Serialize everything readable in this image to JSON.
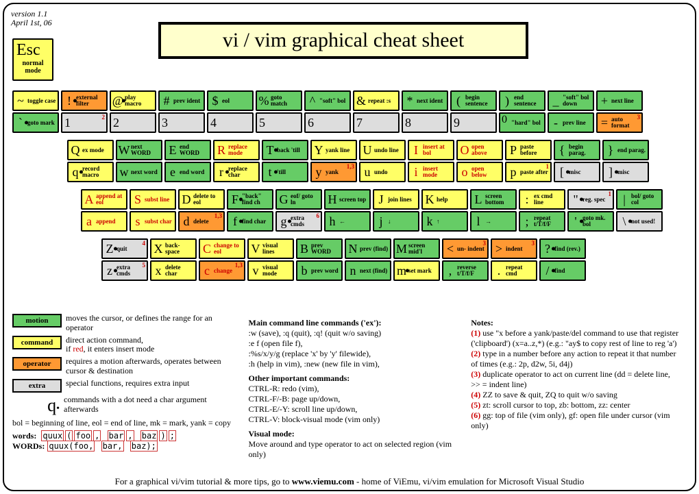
{
  "meta": {
    "version": "version 1.1",
    "date": "April 1st, 06"
  },
  "title": "vi / vim graphical cheat sheet",
  "esc": {
    "label": "Esc",
    "sub": "normal mode"
  },
  "legend": {
    "motion": {
      "tag": "motion",
      "desc": "moves the cursor, or defines the range for an operator"
    },
    "command": {
      "tag": "command",
      "desc_a": "direct action command,",
      "desc_b": "if ",
      "desc_c": "red",
      "desc_d": ", it enters insert mode"
    },
    "operator": {
      "tag": "operator",
      "desc": "requires a motion afterwards, operates between cursor & destination"
    },
    "extra": {
      "tag": "extra",
      "desc": "special functions, requires extra input"
    },
    "qdot": "commands with a dot need a char argument afterwards",
    "abbrev": "bol = beginning of line, eol = end of line, mk = mark, yank = copy",
    "words_lbl": "words:",
    "WORDS_lbl": "WORDs:",
    "sample": "quux(foo, bar, baz);"
  },
  "main_cmds": {
    "h1": "Main command line commands ('ex'):",
    "l1": ":w (save), :q (quit), :q! (quit w/o saving)",
    "l2": ":e f (open file f),",
    "l3": ":%s/x/y/g (replace 'x' by 'y' filewide),",
    "l4": ":h (help in vim), :new (new file in vim),",
    "h2": "Other important commands:",
    "l5": "CTRL-R: redo (vim),",
    "l6": "CTRL-F/-B: page up/down,",
    "l7": "CTRL-E/-Y: scroll line up/down,",
    "l8": "CTRL-V: block-visual mode (vim only)",
    "h3": "Visual mode:",
    "l9": "Move around and type operator to act on selected region (vim only)"
  },
  "notes": {
    "h": "Notes:",
    "n1": "use \"x before a yank/paste/del command to use that register ('clipboard') (x=a..z,*) (e.g.: \"ay$ to copy rest of line to reg 'a')",
    "n2": "type in a number before any action to repeat it that number of times (e.g.: 2p, d2w, 5i, d4j)",
    "n3": "duplicate operator to act on current line (dd = delete line, >> = indent line)",
    "n4": "ZZ to save & quit, ZQ to quit w/o saving",
    "n5": "zt: scroll cursor to top, zb: bottom, zz: center",
    "n6": "gg: top of file (vim only), gf: open file under cursor (vim only)"
  },
  "footer": {
    "a": "For a graphical vi/vim tutorial & more tips, go to ",
    "b": "www.viemu.com",
    "c": "  - home of ViEmu, vi/vim emulation for Microsoft Visual Studio"
  },
  "rows": {
    "r1a": [
      {
        "s": "~",
        "l": "toggle case",
        "c": "command"
      },
      {
        "s": "!",
        "l": "external filter",
        "c": "operator",
        "dot": true
      },
      {
        "s": "@",
        "l": "play macro",
        "c": "command",
        "dot": true
      },
      {
        "s": "#",
        "l": "prev ident",
        "c": "motion"
      },
      {
        "s": "$",
        "l": "eol",
        "c": "motion"
      },
      {
        "s": "%",
        "l": "goto match",
        "c": "motion"
      },
      {
        "s": "^",
        "l": "\"soft\" bol",
        "c": "motion"
      },
      {
        "s": "&",
        "l": "repeat :s",
        "c": "command"
      },
      {
        "s": "*",
        "l": "next ident",
        "c": "motion"
      },
      {
        "s": "(",
        "l": "begin sentence",
        "c": "motion"
      },
      {
        "s": ")",
        "l": "end sentence",
        "c": "motion"
      },
      {
        "s": "_",
        "l": "\"soft\" bol down",
        "c": "motion"
      },
      {
        "s": "+",
        "l": "next line",
        "c": "motion"
      }
    ],
    "r1b": [
      {
        "s": "`",
        "l": "goto mark",
        "c": "motion",
        "dot": true
      },
      {
        "n": "1",
        "sup": "2"
      },
      {
        "n": "2"
      },
      {
        "n": "3"
      },
      {
        "n": "4"
      },
      {
        "n": "5"
      },
      {
        "n": "6"
      },
      {
        "n": "7"
      },
      {
        "n": "8"
      },
      {
        "n": "9"
      },
      {
        "s": "0",
        "l": "\"hard\" bol",
        "c": "motion",
        "zero": true
      },
      {
        "s": "-",
        "l": "prev line",
        "c": "motion"
      },
      {
        "s": "=",
        "l": "auto format",
        "c": "operator",
        "sup": "3"
      }
    ],
    "r2a": [
      {
        "s": "Q",
        "l": "ex mode",
        "c": "command"
      },
      {
        "s": "W",
        "l": "next WORD",
        "c": "motion"
      },
      {
        "s": "E",
        "l": "end WORD",
        "c": "motion"
      },
      {
        "s": "R",
        "l": "replace mode",
        "c": "command",
        "red": true
      },
      {
        "s": "T",
        "l": "back 'till",
        "c": "motion",
        "dot": true
      },
      {
        "s": "Y",
        "l": "yank line",
        "c": "command"
      },
      {
        "s": "U",
        "l": "undo line",
        "c": "command"
      },
      {
        "s": "I",
        "l": "insert at bol",
        "c": "command",
        "red": true
      },
      {
        "s": "O",
        "l": "open above",
        "c": "command",
        "red": true
      },
      {
        "s": "P",
        "l": "paste before",
        "c": "command"
      },
      {
        "s": "{",
        "l": "begin parag.",
        "c": "motion"
      },
      {
        "s": "}",
        "l": "end parag.",
        "c": "motion"
      }
    ],
    "r2b": [
      {
        "s": "q",
        "l": "record macro",
        "c": "command",
        "dot": true
      },
      {
        "s": "w",
        "l": "next word",
        "c": "motion"
      },
      {
        "s": "e",
        "l": "end word",
        "c": "motion"
      },
      {
        "s": "r",
        "l": "replace char",
        "c": "command",
        "dot": true
      },
      {
        "s": "t",
        "l": "'till",
        "c": "motion",
        "dot": true
      },
      {
        "s": "y",
        "l": "yank",
        "c": "operator",
        "sup": "1,3"
      },
      {
        "s": "u",
        "l": "undo",
        "c": "command"
      },
      {
        "s": "i",
        "l": "insert mode",
        "c": "command",
        "red": true
      },
      {
        "s": "o",
        "l": "open below",
        "c": "command",
        "red": true
      },
      {
        "s": "p",
        "l": "paste after",
        "c": "command",
        "sup": "1"
      },
      {
        "s": "[",
        "l": "misc",
        "c": "extra",
        "dot": true
      },
      {
        "s": "]",
        "l": "misc",
        "c": "extra",
        "dot": true
      }
    ],
    "r3a": [
      {
        "s": "A",
        "l": "append at eol",
        "c": "command",
        "red": true
      },
      {
        "s": "S",
        "l": "subst line",
        "c": "command",
        "red": true
      },
      {
        "s": "D",
        "l": "delete to eol",
        "c": "command"
      },
      {
        "s": "F",
        "l": "\"back\" find ch",
        "c": "motion",
        "dot": true
      },
      {
        "s": "G",
        "l": "eof/ goto ln",
        "c": "motion"
      },
      {
        "s": "H",
        "l": "screen top",
        "c": "motion"
      },
      {
        "s": "J",
        "l": "join lines",
        "c": "command"
      },
      {
        "s": "K",
        "l": "help",
        "c": "command"
      },
      {
        "s": "L",
        "l": "screen bottom",
        "c": "motion"
      },
      {
        "s": ":",
        "l": "ex cmd line",
        "c": "command"
      },
      {
        "s": "\"",
        "l": "reg. spec",
        "c": "extra",
        "dot": true,
        "sup": "1"
      },
      {
        "s": "|",
        "l": "bol/ goto col",
        "c": "motion"
      }
    ],
    "r3b": [
      {
        "s": "a",
        "l": "append",
        "c": "command",
        "red": true
      },
      {
        "s": "s",
        "l": "subst char",
        "c": "command",
        "red": true
      },
      {
        "s": "d",
        "l": "delete",
        "c": "operator",
        "sup": "1,3"
      },
      {
        "s": "f",
        "l": "find char",
        "c": "motion",
        "dot": true
      },
      {
        "s": "g",
        "l": "extra cmds",
        "c": "extra",
        "dot": true,
        "sup": "6"
      },
      {
        "s": "h",
        "l": "←",
        "c": "motion",
        "arrow": true
      },
      {
        "s": "j",
        "l": "↓",
        "c": "motion",
        "arrow": true
      },
      {
        "s": "k",
        "l": "↑",
        "c": "motion",
        "arrow": true
      },
      {
        "s": "l",
        "l": "→",
        "c": "motion",
        "arrow": true
      },
      {
        "s": ";",
        "l": "repeat t/T/f/F",
        "c": "motion"
      },
      {
        "s": "'",
        "l": "goto mk. bol",
        "c": "motion",
        "dot": true
      },
      {
        "s": "\\",
        "l": "not used!",
        "c": "extra",
        "dot": true
      }
    ],
    "r4a": [
      {
        "s": "Z",
        "l": "quit",
        "c": "extra",
        "dot": true,
        "sup": "4"
      },
      {
        "s": "X",
        "l": "back- space",
        "c": "command"
      },
      {
        "s": "C",
        "l": "change to eol",
        "c": "command",
        "red": true
      },
      {
        "s": "V",
        "l": "visual lines",
        "c": "command"
      },
      {
        "s": "B",
        "l": "prev WORD",
        "c": "motion"
      },
      {
        "s": "N",
        "l": "prev (find)",
        "c": "motion"
      },
      {
        "s": "M",
        "l": "screen mid'l",
        "c": "motion"
      },
      {
        "s": "<",
        "l": "un- indent",
        "c": "operator",
        "sup": "3"
      },
      {
        "s": ">",
        "l": "indent",
        "c": "operator",
        "sup": "3"
      },
      {
        "s": "?",
        "l": "find (rev.)",
        "c": "motion",
        "dot": true
      }
    ],
    "r4b": [
      {
        "s": "z",
        "l": "extra cmds",
        "c": "extra",
        "dot": true,
        "sup": "5"
      },
      {
        "s": "x",
        "l": "delete char",
        "c": "command"
      },
      {
        "s": "c",
        "l": "change",
        "c": "operator",
        "red": true,
        "sup": "1,3"
      },
      {
        "s": "v",
        "l": "visual mode",
        "c": "command"
      },
      {
        "s": "b",
        "l": "prev word",
        "c": "motion"
      },
      {
        "s": "n",
        "l": "next (find)",
        "c": "motion"
      },
      {
        "s": "m",
        "l": "set mark",
        "c": "command",
        "dot": true
      },
      {
        "s": ",",
        "l": "reverse t/T/f/F",
        "c": "motion"
      },
      {
        "s": ".",
        "l": "repeat cmd",
        "c": "command"
      },
      {
        "s": "/",
        "l": "find",
        "c": "motion",
        "dot": true
      }
    ]
  }
}
